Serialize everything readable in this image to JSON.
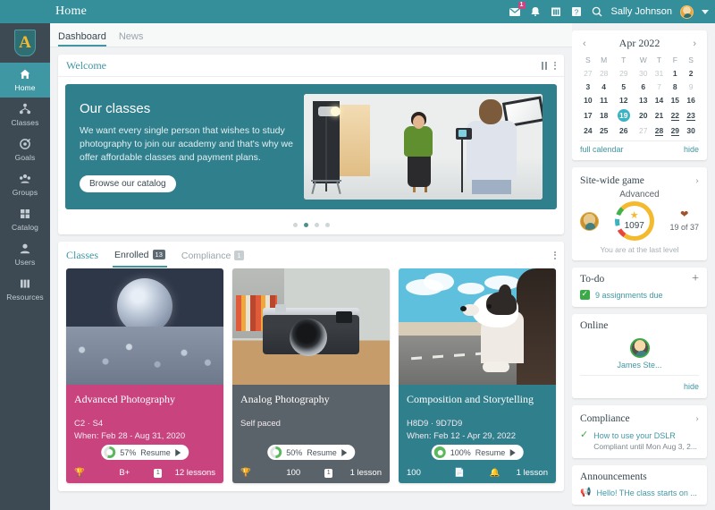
{
  "topbar": {
    "title": "Home",
    "user_name": "Sally Johnson",
    "mail_badge": "1",
    "icons": [
      "mail-icon",
      "bell-icon",
      "calendar-icon",
      "help-icon",
      "search-icon"
    ]
  },
  "sidebar": {
    "logo_letter": "A",
    "items": [
      {
        "label": "Home",
        "icon": "home-icon",
        "active": true
      },
      {
        "label": "Classes",
        "icon": "classes-icon",
        "active": false
      },
      {
        "label": "Goals",
        "icon": "goals-icon",
        "active": false
      },
      {
        "label": "Groups",
        "icon": "groups-icon",
        "active": false
      },
      {
        "label": "Catalog",
        "icon": "catalog-icon",
        "active": false
      },
      {
        "label": "Users",
        "icon": "users-icon",
        "active": false
      },
      {
        "label": "Resources",
        "icon": "resources-icon",
        "active": false
      }
    ]
  },
  "page_tabs": [
    {
      "label": "Dashboard",
      "active": true
    },
    {
      "label": "News",
      "active": false
    }
  ],
  "welcome": {
    "title": "Welcome",
    "hero": {
      "heading": "Our classes",
      "text": "We want every single person that wishes to study photography to join our academy and that's why we offer affordable classes and payment plans.",
      "button": "Browse our catalog"
    },
    "carousel_dots": 4,
    "carousel_active_index": 1
  },
  "classes": {
    "title": "Classes",
    "tabs": [
      {
        "label": "Enrolled",
        "count": "13",
        "active": true
      },
      {
        "label": "Compliance",
        "count": "1",
        "active": false
      }
    ],
    "cards": [
      {
        "title": "Advanced Photography",
        "code": "C2 · S4",
        "when": "When: Feb 28 - Aug 31, 2020",
        "progress": "57%",
        "resume_label": "Resume",
        "grade": "B+",
        "badge": "1",
        "lessons": "12 lessons",
        "color": "#c9437f",
        "icons": [
          "trophy-icon",
          "certificate-icon"
        ]
      },
      {
        "title": "Analog Photography",
        "code": "Self paced",
        "when": "",
        "progress": "50%",
        "resume_label": "Resume",
        "grade": "100",
        "badge": "1",
        "lessons": "1 lesson",
        "color": "#5b636a",
        "icons": [
          "trophy-icon",
          "certificate-icon"
        ]
      },
      {
        "title": "Composition and Storytelling",
        "code": "H8D9 · 9D7D9",
        "when": "When: Feb 12 - Apr 29, 2022",
        "progress": "100%",
        "resume_label": "Resume",
        "grade": "100",
        "badge": "",
        "lessons": "1 lesson",
        "color": "#2f7f8c",
        "icons": [
          "document-icon",
          "bell-icon"
        ]
      }
    ]
  },
  "calendar": {
    "month": "Apr 2022",
    "weekdays": [
      "S",
      "M",
      "T",
      "W",
      "T",
      "F",
      "S"
    ],
    "weeks": [
      [
        {
          "d": "27",
          "muted": true
        },
        {
          "d": "28",
          "muted": true
        },
        {
          "d": "29",
          "muted": true
        },
        {
          "d": "30",
          "muted": true
        },
        {
          "d": "31",
          "muted": true
        },
        {
          "d": "1"
        },
        {
          "d": "2"
        }
      ],
      [
        {
          "d": "3"
        },
        {
          "d": "4"
        },
        {
          "d": "5"
        },
        {
          "d": "6"
        },
        {
          "d": "7",
          "muted": true
        },
        {
          "d": "8"
        },
        {
          "d": "9",
          "muted": true
        }
      ],
      [
        {
          "d": "10"
        },
        {
          "d": "11"
        },
        {
          "d": "12"
        },
        {
          "d": "13"
        },
        {
          "d": "14"
        },
        {
          "d": "15"
        },
        {
          "d": "16"
        }
      ],
      [
        {
          "d": "17"
        },
        {
          "d": "18"
        },
        {
          "d": "19",
          "today": true
        },
        {
          "d": "20"
        },
        {
          "d": "21"
        },
        {
          "d": "22",
          "underline": true
        },
        {
          "d": "23",
          "underline": true
        }
      ],
      [
        {
          "d": "24"
        },
        {
          "d": "25"
        },
        {
          "d": "26"
        },
        {
          "d": "27",
          "muted": true
        },
        {
          "d": "28",
          "underline": true
        },
        {
          "d": "29",
          "underline": true
        },
        {
          "d": "30"
        }
      ]
    ],
    "full_calendar_link": "full calendar",
    "hide_link": "hide"
  },
  "game": {
    "title": "Site-wide game",
    "level": "Advanced",
    "points": "1097",
    "badges": "19 of 37",
    "note": "You are at the last level"
  },
  "todo": {
    "title": "To-do",
    "add_label": "+",
    "item": "9 assignments due"
  },
  "online": {
    "title": "Online",
    "user": "James Ste...",
    "hide_link": "hide"
  },
  "compliance": {
    "title": "Compliance",
    "item_title": "How to use your DSLR",
    "item_sub": "Compliant until Mon Aug 3, 2..."
  },
  "announcements": {
    "title": "Announcements",
    "item": "Hello! THe class starts on ..."
  },
  "colors": {
    "brand_teal": "#348f9b",
    "accent_teal": "#3f97a3",
    "sidebar_dark": "#3d4a54",
    "pink": "#c9437f",
    "grey_card": "#5b636a",
    "today_highlight": "#3bb3c3",
    "green": "#3aa948"
  }
}
